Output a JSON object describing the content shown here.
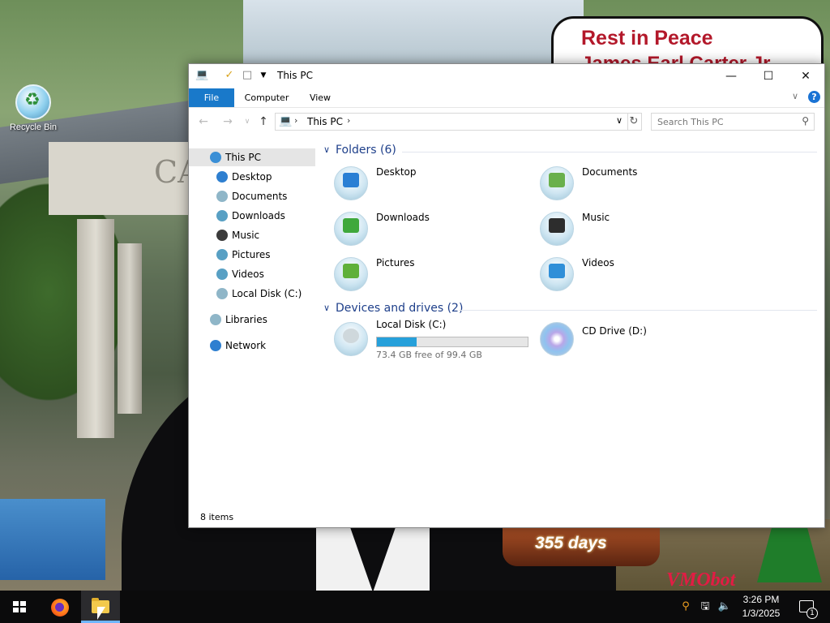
{
  "desktop": {
    "banner_line1": "Rest in Peace",
    "banner_line2": "James Earl Carter Jr.",
    "building_text": "CA",
    "recycle_bin_label": "Recycle Bin",
    "globe_text": "355 days",
    "logo_text": "VMObot"
  },
  "window": {
    "title": "This PC",
    "quick_access": [
      "properties-icon",
      "new-folder-icon",
      "customize-dropdown"
    ],
    "controls": {
      "minimize": "—",
      "maximize": "☐",
      "close": "✕"
    },
    "ribbon_tabs": [
      "File",
      "Computer",
      "View"
    ],
    "help": "?",
    "address": {
      "crumb": "This PC",
      "separator": "›"
    },
    "search_placeholder": "Search This PC",
    "nav_pane": [
      {
        "label": "This PC",
        "icon": "this-pc-icon",
        "selected": true,
        "color": "#3a8fd6"
      },
      {
        "label": "Desktop",
        "icon": "desktop-icon",
        "color": "#2e7fd0"
      },
      {
        "label": "Documents",
        "icon": "documents-icon",
        "color": "#8fb6c8"
      },
      {
        "label": "Downloads",
        "icon": "downloads-icon",
        "color": "#58a0c4"
      },
      {
        "label": "Music",
        "icon": "music-icon",
        "color": "#3b3b3b"
      },
      {
        "label": "Pictures",
        "icon": "pictures-icon",
        "color": "#58a0c4"
      },
      {
        "label": "Videos",
        "icon": "videos-icon",
        "color": "#58a0c4"
      },
      {
        "label": "Local Disk (C:)",
        "icon": "local-disk-icon",
        "color": "#8fb6c8"
      },
      {
        "label": "Libraries",
        "icon": "libraries-icon",
        "color": "#8fb6c8"
      },
      {
        "label": "Network",
        "icon": "network-icon",
        "color": "#2e7fd0"
      }
    ],
    "folders_header": "Folders (6)",
    "folders": [
      {
        "label": "Desktop",
        "icon": "desktop-folder-icon",
        "color": "#2a7fd4"
      },
      {
        "label": "Documents",
        "icon": "documents-folder-icon",
        "color": "#6ab04c"
      },
      {
        "label": "Downloads",
        "icon": "downloads-folder-icon",
        "color": "#3fa83c"
      },
      {
        "label": "Music",
        "icon": "music-folder-icon",
        "color": "#2d2d2d"
      },
      {
        "label": "Pictures",
        "icon": "pictures-folder-icon",
        "color": "#5fb03a"
      },
      {
        "label": "Videos",
        "icon": "videos-folder-icon",
        "color": "#2f8fd8"
      }
    ],
    "drives_header": "Devices and drives (2)",
    "drives": [
      {
        "label": "Local Disk (C:)",
        "free_text": "73.4 GB free of 99.4 GB",
        "used_fraction": 0.262,
        "icon": "local-disk-icon"
      },
      {
        "label": "CD Drive (D:)",
        "icon": "cd-drive-icon"
      }
    ],
    "status_text": "8 items"
  },
  "taskbar": {
    "time": "3:26 PM",
    "date": "1/3/2025",
    "notification_count": "1",
    "apps": [
      "start-button",
      "firefox",
      "file-explorer"
    ],
    "tray": [
      "search-tray-icon",
      "network-icon",
      "volume-muted-icon"
    ]
  },
  "colors": {
    "accent": "#1979ca",
    "drive_bar": "#26a0da",
    "group_header": "#1e3f8a",
    "taskbar": "#0b0b0c"
  }
}
